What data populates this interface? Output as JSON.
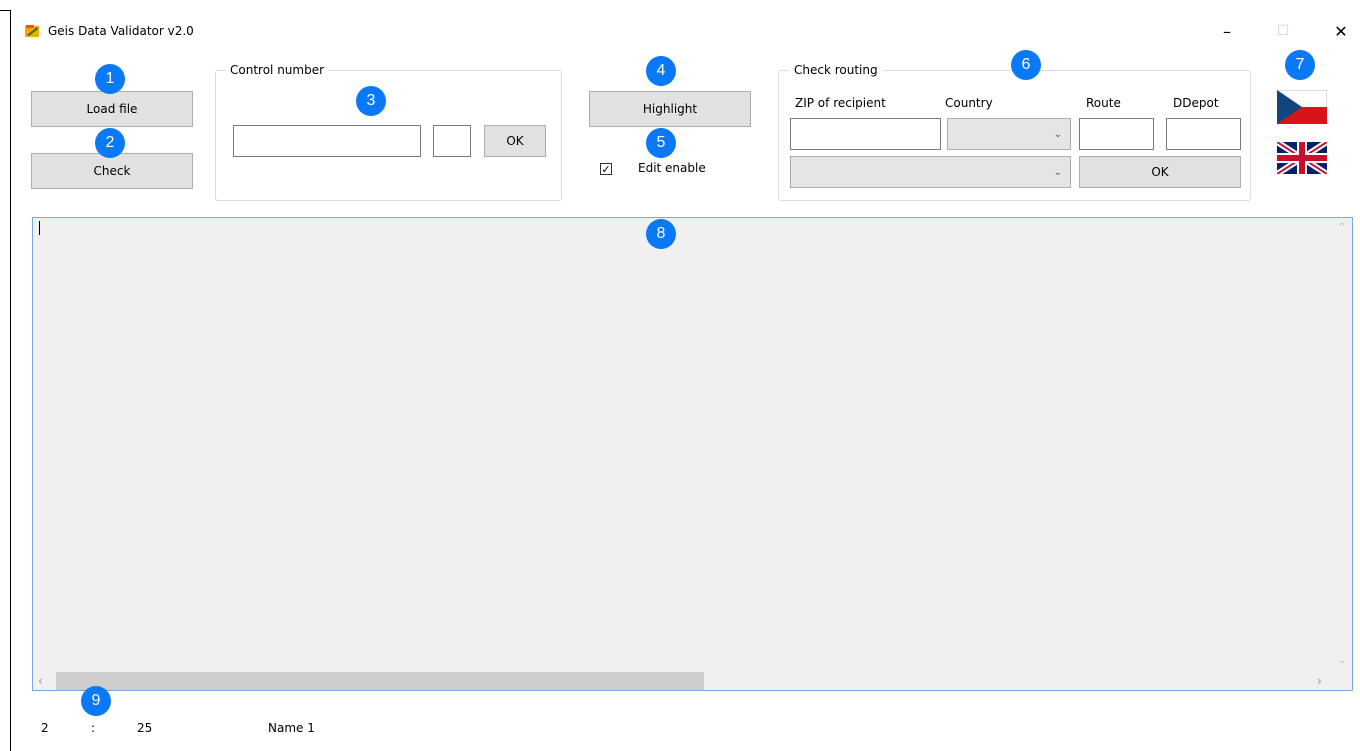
{
  "window": {
    "title": "Geis Data Validator v2.0",
    "controls": {
      "minimize": "–",
      "maximize": "☐",
      "close": "✕"
    }
  },
  "toolbar": {
    "load_file": "Load file",
    "check": "Check",
    "highlight": "Highlight"
  },
  "control_number": {
    "label": "Control number",
    "number_value": "",
    "check_digit_value": "",
    "ok": "OK"
  },
  "edit_enable": {
    "label": "Edit enable",
    "checked": true
  },
  "check_routing": {
    "label": "Check routing",
    "columns": [
      "ZIP of recipient",
      "Country",
      "Route",
      "DDepot"
    ],
    "zip_value": "",
    "country_value": "",
    "route_value": "",
    "ddepot_value": "",
    "depot_select_value": "",
    "ok": "OK"
  },
  "languages": [
    {
      "name": "czech-flag-icon"
    },
    {
      "name": "uk-flag-icon"
    }
  ],
  "callouts": [
    "1",
    "2",
    "3",
    "4",
    "5",
    "6",
    "7",
    "8",
    "9"
  ],
  "editor": {
    "content": ""
  },
  "status_bar": {
    "line": "2",
    "separator": ":",
    "column": "25",
    "name": "Name 1"
  },
  "colors": {
    "callout": "#0a79f7",
    "button_bg": "#e1e1e1",
    "editor_bg": "#f0f0f0",
    "flag_red": "#d7141a",
    "flag_blue": "#11457e"
  }
}
